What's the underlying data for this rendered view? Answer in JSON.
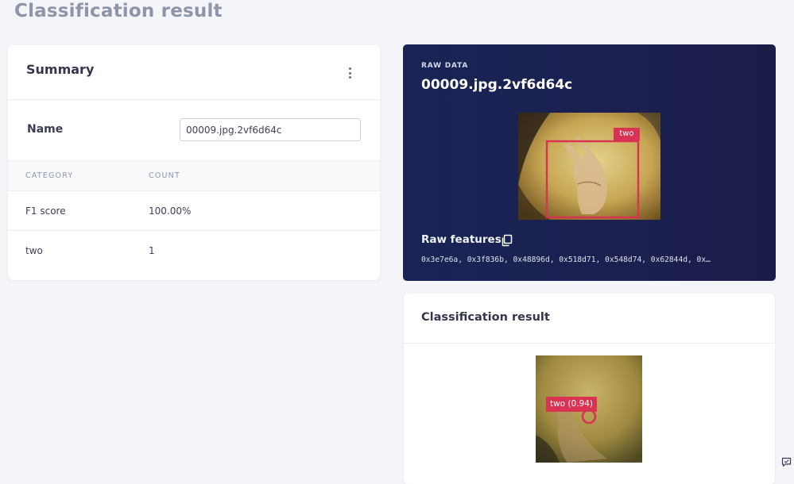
{
  "page": {
    "title": "Classification result"
  },
  "summary": {
    "title": "Summary",
    "name_label": "Name",
    "name_value": "00009.jpg.2vf6d64c",
    "columns": [
      "CATEGORY",
      "COUNT"
    ],
    "rows": [
      {
        "category": "F1 score",
        "count": "100.00%"
      },
      {
        "category": "two",
        "count": "1"
      }
    ]
  },
  "raw_data": {
    "eyebrow": "RAW DATA",
    "name": "00009.jpg.2vf6d64c",
    "bbox_label": "two",
    "features_label": "Raw features",
    "features_value": "0x3e7e6a, 0x3f836b, 0x48896d, 0x518d71, 0x548d74, 0x62844d, 0x…"
  },
  "classification": {
    "title": "Classification result",
    "result_label": "two (0.94)"
  },
  "colors": {
    "accent_red": "#d93253",
    "raw_bg": "#1b2050",
    "page_bg": "#f4f5f9"
  },
  "icons": [
    "kebab-menu-icon",
    "copy-icon",
    "feedback-icon"
  ]
}
